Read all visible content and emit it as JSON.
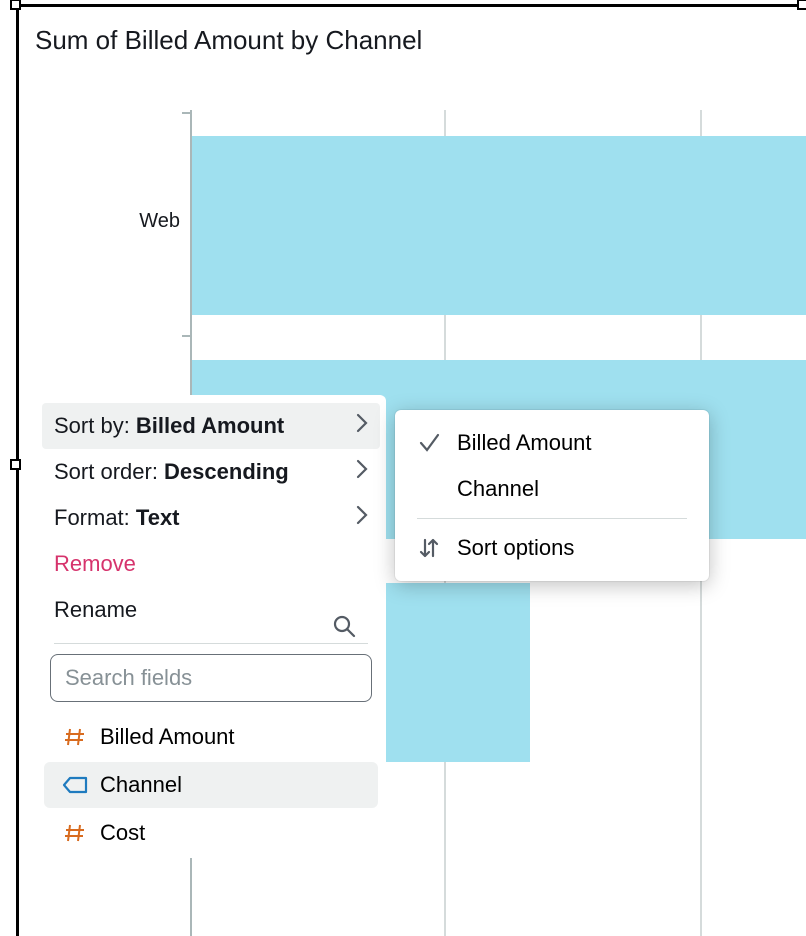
{
  "chart_data": {
    "type": "bar",
    "orientation": "horizontal",
    "title": "Sum of Billed Amount by Channel",
    "xlabel": "",
    "ylabel": "",
    "categories": [
      "Web",
      "",
      ""
    ],
    "values": [
      100,
      100,
      55
    ],
    "xlim": [
      0,
      100
    ],
    "bar_color": "#9fe0ef"
  },
  "menu1": {
    "sort_by_prefix": "Sort by: ",
    "sort_by_value": "Billed Amount",
    "sort_order_prefix": "Sort order: ",
    "sort_order_value": "Descending",
    "format_prefix": "Format: ",
    "format_value": "Text",
    "remove": "Remove",
    "rename": "Rename",
    "search_placeholder": "Search fields",
    "fields": {
      "f0": "Billed Amount",
      "f1": "Channel",
      "f2": "Cost"
    }
  },
  "menu2": {
    "opt0": "Billed Amount",
    "opt1": "Channel",
    "sort_options": "Sort options"
  }
}
